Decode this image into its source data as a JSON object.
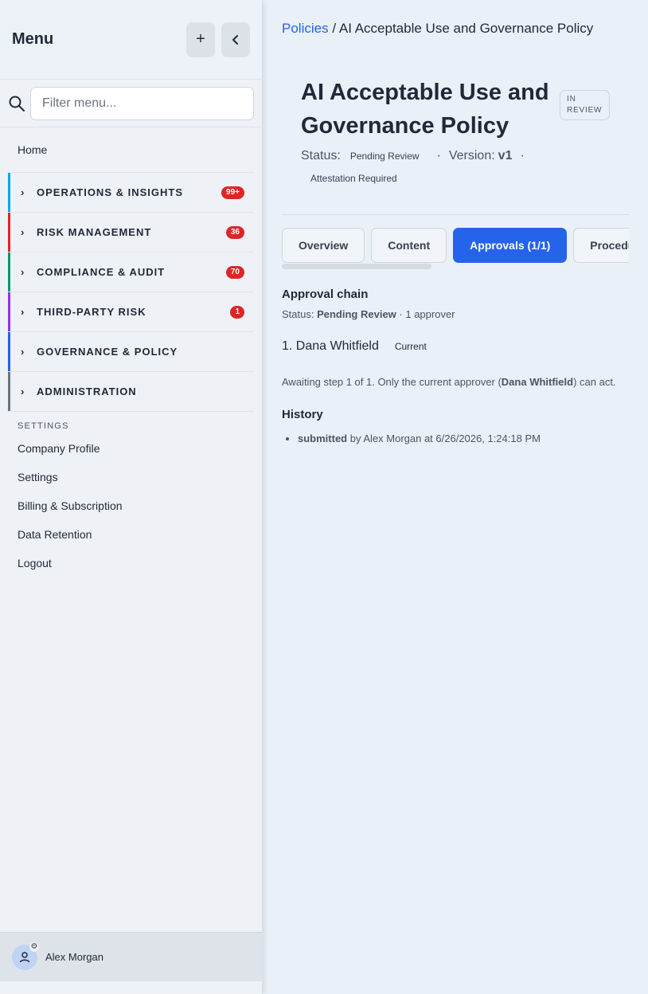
{
  "sidebar": {
    "title": "Menu",
    "add_icon": "plus-icon",
    "collapse_icon": "chevron-left-icon",
    "filter_placeholder": "Filter menu...",
    "home": "Home",
    "sections": [
      {
        "label": "OPERATIONS & INSIGHTS",
        "badge": "99+",
        "color": "#0ea5e9"
      },
      {
        "label": "RISK MANAGEMENT",
        "badge": "36",
        "color": "#dc2626"
      },
      {
        "label": "COMPLIANCE & AUDIT",
        "badge": "70",
        "color": "#059669"
      },
      {
        "label": "THIRD-PARTY RISK",
        "badge": "1",
        "color": "#9333ea"
      },
      {
        "label": "GOVERNANCE & POLICY",
        "badge": "",
        "color": "#2563eb"
      },
      {
        "label": "ADMINISTRATION",
        "badge": "",
        "color": "#6b7280"
      }
    ],
    "settings_heading": "SETTINGS",
    "settings_items": [
      "Company Profile",
      "Settings",
      "Billing & Subscription",
      "Data Retention",
      "Logout"
    ],
    "user_name": "Alex Morgan"
  },
  "breadcrumb": {
    "parent": "Policies",
    "separator": "/",
    "current": "AI Acceptable Use and Governance Policy"
  },
  "page": {
    "title": "AI Acceptable Use and Governance Policy",
    "state_pill": "IN REVIEW",
    "status_label": "Status:",
    "status_value": "Pending Review",
    "version_label": "Version:",
    "version_value": "v1",
    "dot": "·",
    "attestation": "Attestation Required"
  },
  "tabs": [
    "Overview",
    "Content",
    "Approvals (1/1)",
    "Procedures"
  ],
  "approval": {
    "heading": "Approval chain",
    "status_prefix": "Status:",
    "status_value": "Pending Review",
    "status_suffix": "· 1 approver",
    "approver": "1. Dana Whitfield",
    "approver_tag": "Current",
    "await_prefix": "Awaiting step 1 of 1. Only the current approver (",
    "await_name": "Dana Whitfield",
    "await_suffix": ") can act."
  },
  "history": {
    "heading": "History",
    "items": [
      {
        "action": "submitted",
        "rest": " by Alex Morgan at 6/26/2026, 1:24:18 PM"
      }
    ]
  }
}
